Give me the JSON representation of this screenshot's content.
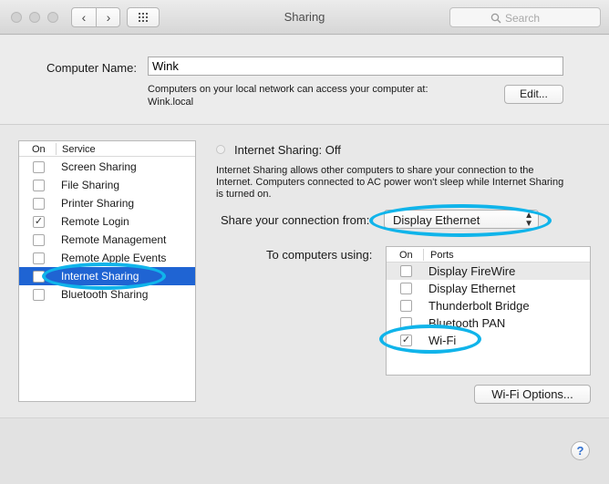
{
  "window": {
    "title": "Sharing"
  },
  "search": {
    "placeholder": "Search"
  },
  "computer_name": {
    "label": "Computer Name:",
    "value": "Wink",
    "description_line1": "Computers on your local network can access your computer at:",
    "description_line2": "Wink.local",
    "edit_label": "Edit..."
  },
  "service_list": {
    "header_on": "On",
    "header_service": "Service",
    "items": [
      {
        "label": "Screen Sharing",
        "checked": false
      },
      {
        "label": "File Sharing",
        "checked": false
      },
      {
        "label": "Printer Sharing",
        "checked": false
      },
      {
        "label": "Remote Login",
        "checked": true
      },
      {
        "label": "Remote Management",
        "checked": false
      },
      {
        "label": "Remote Apple Events",
        "checked": false
      },
      {
        "label": "Internet Sharing",
        "checked": false,
        "selected": true
      },
      {
        "label": "Bluetooth Sharing",
        "checked": false
      }
    ]
  },
  "internet_sharing": {
    "status_title": "Internet Sharing: Off",
    "description": "Internet Sharing allows other computers to share your connection to the Internet. Computers connected to AC power won't sleep while Internet Sharing is turned on.",
    "share_from_label": "Share your connection from:",
    "share_from_value": "Display Ethernet",
    "to_computers_label": "To computers using:",
    "ports_header_on": "On",
    "ports_header_ports": "Ports",
    "ports": [
      {
        "label": "Display FireWire",
        "checked": false
      },
      {
        "label": "Display Ethernet",
        "checked": false
      },
      {
        "label": "Thunderbolt Bridge",
        "checked": false
      },
      {
        "label": "Bluetooth PAN",
        "checked": false
      },
      {
        "label": "Wi-Fi",
        "checked": true
      }
    ],
    "options_button": "Wi-Fi Options..."
  },
  "help": {
    "label": "?"
  },
  "colors": {
    "selection": "#1f64d3",
    "annotation": "#10b4ea"
  }
}
